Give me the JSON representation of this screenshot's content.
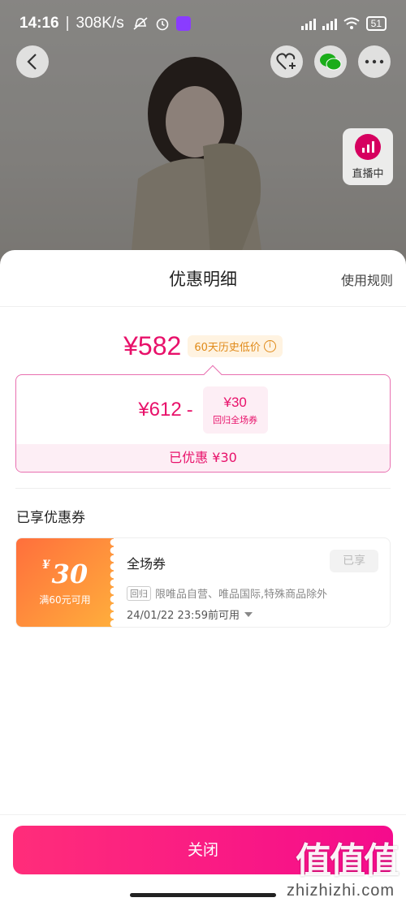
{
  "status_bar": {
    "time": "14:16",
    "speed": "308K/s",
    "battery": "51"
  },
  "live_badge": {
    "label": "直播中"
  },
  "sheet": {
    "title": "优惠明细",
    "rules_link": "使用规则"
  },
  "price": {
    "final": "¥582",
    "low_badge": "60天历史低价",
    "info_glyph": "i",
    "original": "¥612",
    "minus": "-",
    "discount_value": "¥30",
    "discount_label": "回归全场券",
    "saved_text": "已优惠 ¥30"
  },
  "coupons_section": {
    "title": "已享优惠券",
    "coupons": [
      {
        "currency": "¥",
        "amount": "30",
        "condition": "满60元可用",
        "name": "全场券",
        "status": "已享",
        "tag": "回归",
        "description": "限唯品自营、唯品国际,特殊商品除外",
        "expiry": "24/01/22 23:59前可用"
      }
    ]
  },
  "bottom": {
    "close_label": "关闭",
    "watermark": "值值值",
    "watermark_url": "zhizhizhi.com"
  },
  "colors": {
    "accent": "#e8116a",
    "button_gradient_start": "#ff2d7a",
    "button_gradient_end": "#f50b8c",
    "coupon_gradient_start": "#ff6f3c",
    "coupon_gradient_end": "#ffae3c",
    "badge_orange": "#e08a19"
  },
  "icons": [
    "back-icon",
    "favorite-add-icon",
    "wechat-icon",
    "more-icon",
    "live-icon",
    "info-icon",
    "dropdown-icon"
  ]
}
